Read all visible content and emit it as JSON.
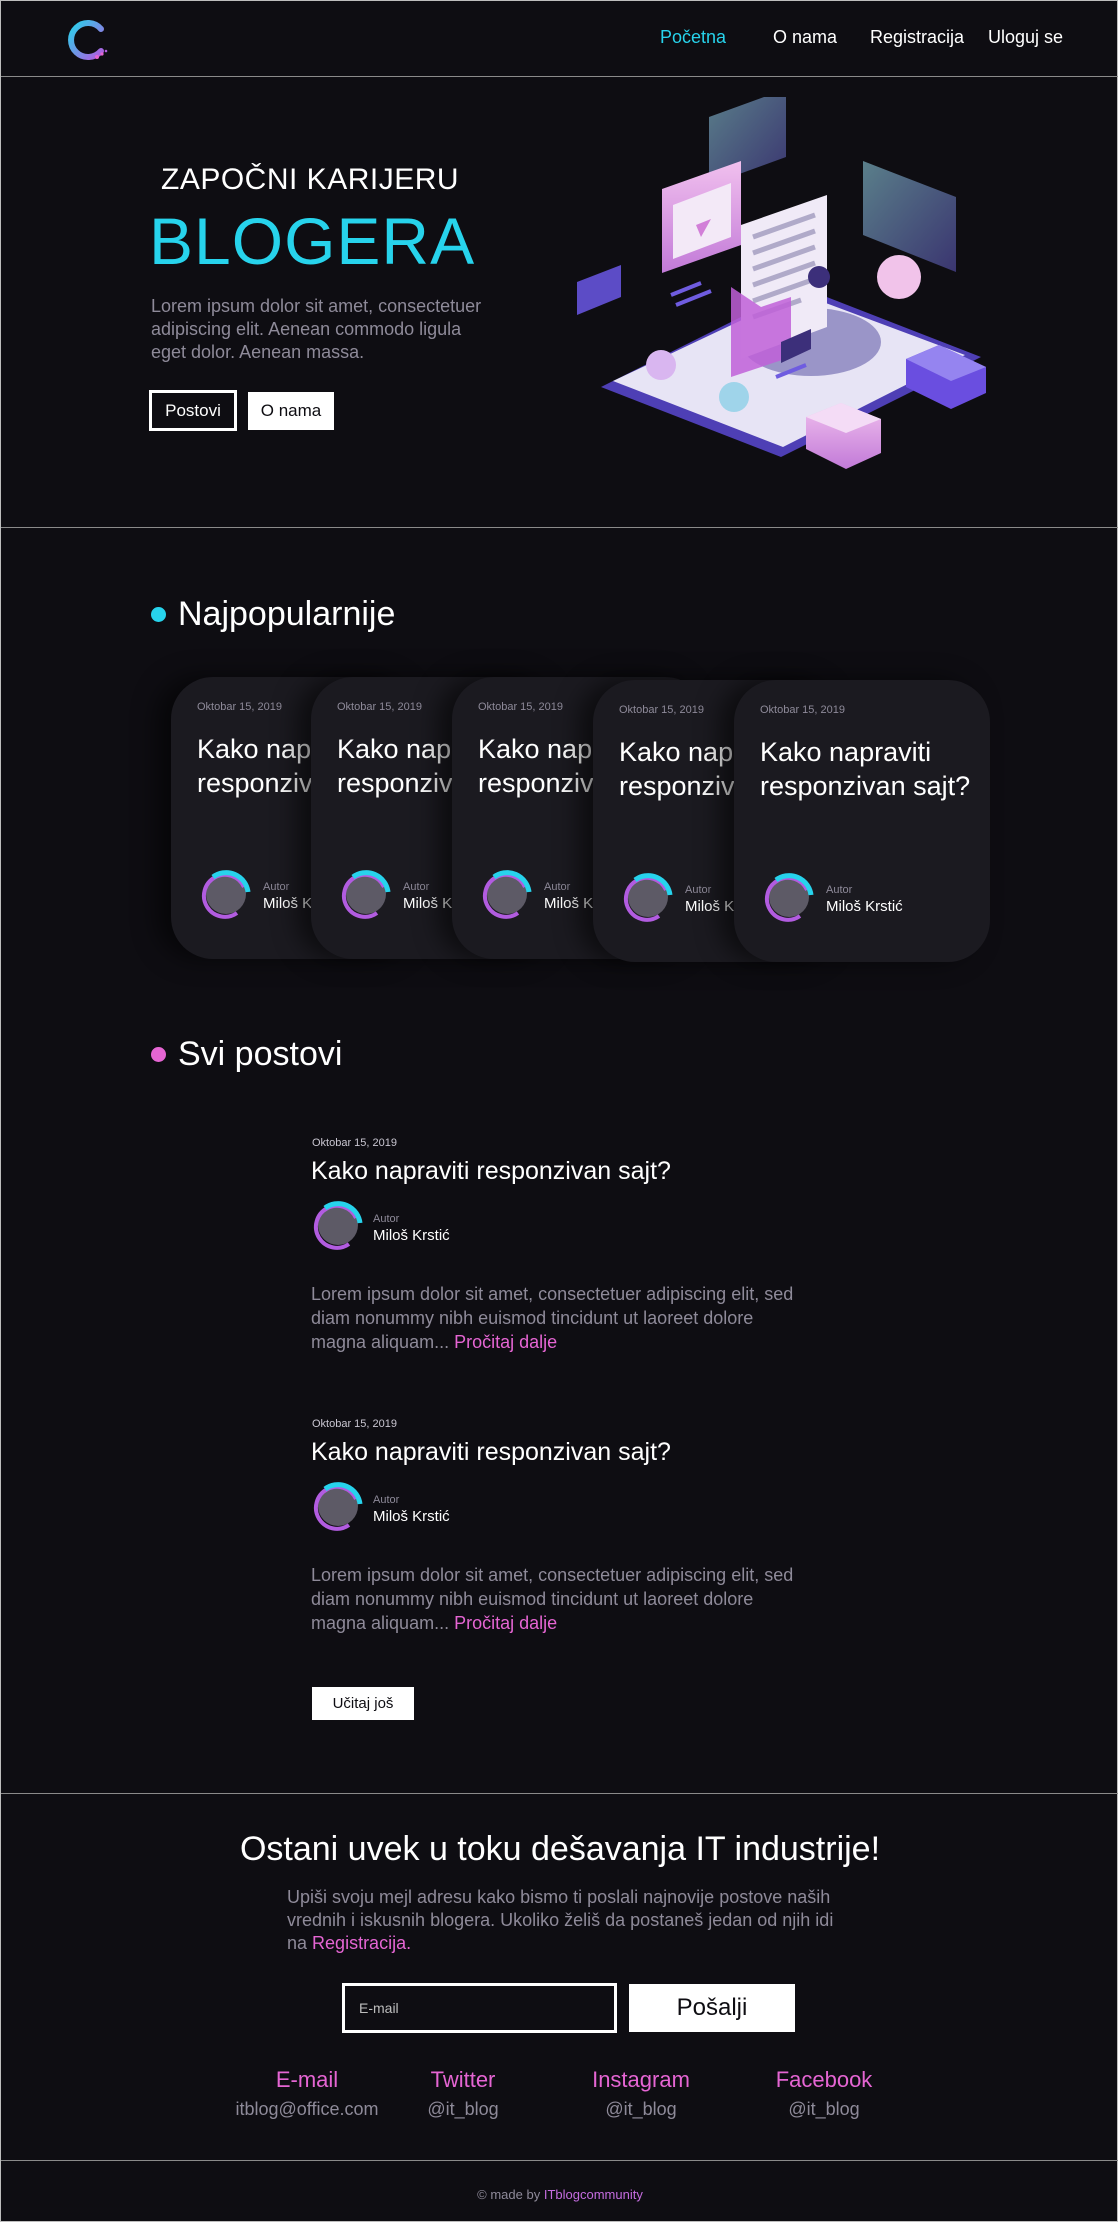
{
  "nav": {
    "links": [
      "Početna",
      "O nama",
      "Registracija",
      "Uloguj se"
    ]
  },
  "hero": {
    "kicker": "ZAPOČNI KARIJERU",
    "title": "BLOGERA",
    "description": "Lorem ipsum dolor sit amet, consectetuer adipiscing elit. Aenean commodo ligula eget dolor. Aenean massa.",
    "btn_posts": "Postovi",
    "btn_about": "O nama"
  },
  "popular": {
    "heading": "Najpopularnije",
    "cards": [
      {
        "date": "Oktobar 15, 2019",
        "title": "Kako napraviti responzivan sajt?",
        "author_label": "Autor",
        "author": "Miloš Krstić"
      },
      {
        "date": "Oktobar 15, 2019",
        "title": "Kako napraviti responzivan sajt?",
        "author_label": "Autor",
        "author": "Miloš Krstić"
      },
      {
        "date": "Oktobar 15, 2019",
        "title": "Kako napraviti responzivan sajt?",
        "author_label": "Autor",
        "author": "Miloš Krstić"
      },
      {
        "date": "Oktobar 15, 2019",
        "title": "Kako napraviti responzivan sajt?",
        "author_label": "Autor",
        "author": "Miloš Krstić"
      },
      {
        "date": "Oktobar 15, 2019",
        "title": "Kako napraviti responzivan sajt?",
        "author_label": "Autor",
        "author": "Miloš Krstić"
      }
    ]
  },
  "all_posts": {
    "heading": "Svi postovi",
    "posts": [
      {
        "date": "Oktobar 15, 2019",
        "title": "Kako napraviti responzivan sajt?",
        "author_label": "Autor",
        "author": "Miloš Krstić",
        "excerpt": "Lorem ipsum dolor sit amet, consectetuer adipiscing elit, sed diam nonummy nibh euismod tincidunt ut laoreet dolore magna aliquam...",
        "read_more": "Pročitaj dalje"
      },
      {
        "date": "Oktobar 15, 2019",
        "title": "Kako napraviti responzivan sajt?",
        "author_label": "Autor",
        "author": "Miloš Krstić",
        "excerpt": "Lorem ipsum dolor sit amet, consectetuer adipiscing elit, sed diam nonummy nibh euismod tincidunt ut laoreet dolore magna aliquam...",
        "read_more": "Pročitaj dalje"
      }
    ],
    "load_more": "Učitaj još"
  },
  "newsletter": {
    "title": "Ostani uvek u toku dešavanja IT industrije!",
    "description": "Upiši svoju mejl adresu kako bismo ti poslali najnovije postove naših vrednih i iskusnih blogera. Ukoliko želiš da postaneš jedan od njih idi na",
    "link": "Registracija.",
    "email_placeholder": "E-mail",
    "send": "Pošalji"
  },
  "contacts": [
    {
      "title": "E-mail",
      "value": "itblog@office.com"
    },
    {
      "title": "Twitter",
      "value": "@it_blog"
    },
    {
      "title": "Instagram",
      "value": "@it_blog"
    },
    {
      "title": "Facebook",
      "value": "@it_blog"
    }
  ],
  "footer": {
    "prefix": "© made by",
    "brand": "ITblogcommunity"
  },
  "colors": {
    "background": "#0e0d12",
    "accent_cyan": "#27d3ec",
    "accent_pink": "#e565d3",
    "muted_text": "#8e8a99"
  },
  "icons": [
    "logo-icon",
    "avatar-icon",
    "hero-illustration"
  ]
}
